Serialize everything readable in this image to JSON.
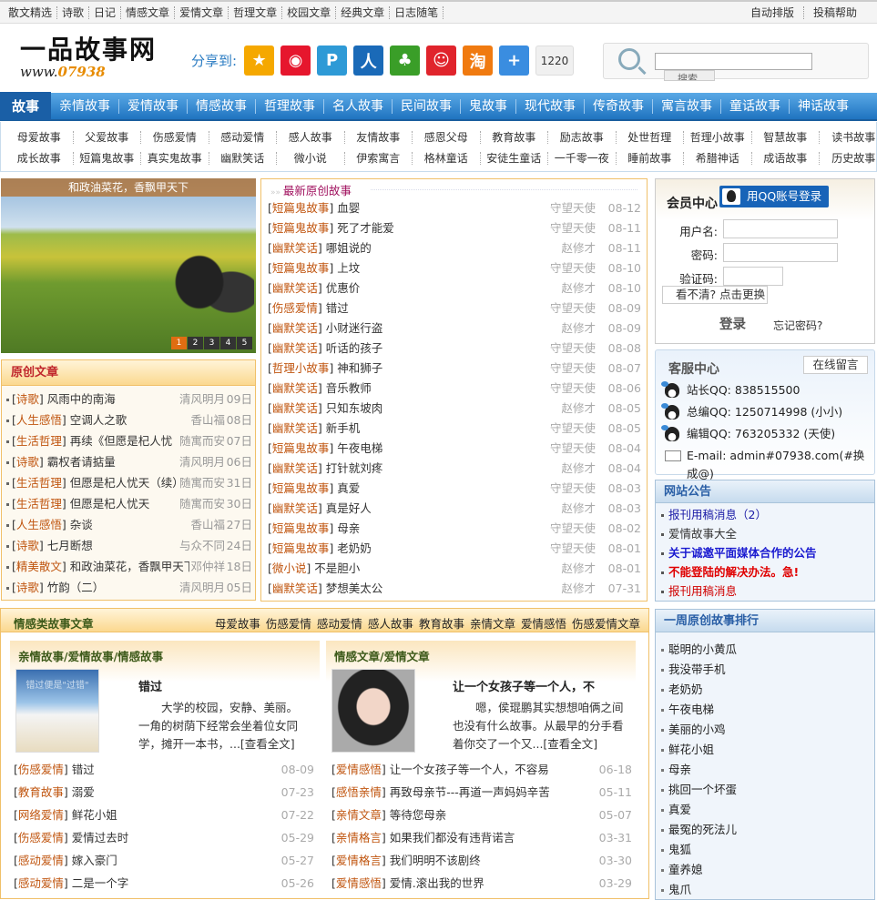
{
  "topbar": {
    "links": [
      "散文精选",
      "诗歌",
      "日记",
      "情感文章",
      "爱情文章",
      "哲理文章",
      "校园文章",
      "经典文章",
      "日志随笔"
    ],
    "right": [
      "自动排版",
      "投稿帮助"
    ]
  },
  "logo": {
    "title": "一品故事网",
    "url_prefix": "www.",
    "url_num": "07938",
    ".com": ".com"
  },
  "share": {
    "label": "分享到:",
    "icons": [
      {
        "name": "qzone-icon",
        "color": "#f5a800",
        "glyph": "★"
      },
      {
        "name": "weibo-icon",
        "color": "#e6162d",
        "glyph": "◉"
      },
      {
        "name": "tencent-weibo-icon",
        "color": "#2e9ad6",
        "glyph": "P"
      },
      {
        "name": "renren-icon",
        "color": "#1a6ab8",
        "glyph": "人"
      },
      {
        "name": "kaixin-icon",
        "color": "#3a9e28",
        "glyph": "♣"
      },
      {
        "name": "pengyou-icon",
        "color": "#e0242c",
        "glyph": "☺"
      },
      {
        "name": "taobao-icon",
        "color": "#f07a10",
        "glyph": "淘"
      },
      {
        "name": "more-share-icon",
        "color": "#3a8de0",
        "glyph": "+"
      }
    ],
    "count": "1220"
  },
  "search": {
    "value": "",
    "button": "搜索"
  },
  "nav": {
    "home": "故事",
    "items": [
      "亲情故事",
      "爱情故事",
      "情感故事",
      "哲理故事",
      "名人故事",
      "民间故事",
      "鬼故事",
      "现代故事",
      "传奇故事",
      "寓言故事",
      "童话故事",
      "神话故事"
    ]
  },
  "subnav": {
    "row1": [
      "母爱故事",
      "父爱故事",
      "伤感爱情",
      "感动爱情",
      "感人故事",
      "友情故事",
      "感恩父母",
      "教育故事",
      "励志故事",
      "处世哲理",
      "哲理小故事",
      "智慧故事",
      "读书故事"
    ],
    "row2": [
      "成长故事",
      "短篇鬼故事",
      "真实鬼故事",
      "幽默笑话",
      "微小说",
      "伊索寓言",
      "格林童话",
      "安徒生童话",
      "一千零一夜",
      "睡前故事",
      "希腊神话",
      "成语故事",
      "历史故事"
    ]
  },
  "banner": {
    "caption": "和政油菜花，香飘甲天下",
    "slides": [
      "1",
      "2",
      "3",
      "4",
      "5"
    ],
    "active_slide": 1
  },
  "original": {
    "title": "原创文章",
    "items": [
      {
        "cat": "诗歌",
        "title": "风雨中的南海",
        "author": "清风明月",
        "date": "09日"
      },
      {
        "cat": "人生感悟",
        "title": "空调人之歌",
        "author": "香山福",
        "date": "08日"
      },
      {
        "cat": "生活哲理",
        "title": "再续《但愿是杞人忧",
        "author": "随寓而安",
        "date": "07日"
      },
      {
        "cat": "诗歌",
        "title": "霸权者请掂量",
        "author": "清风明月",
        "date": "06日"
      },
      {
        "cat": "生活哲理",
        "title": "但愿是杞人忧天（续）",
        "author": "随寓而安",
        "date": "31日"
      },
      {
        "cat": "生活哲理",
        "title": "但愿是杞人忧天",
        "author": "随寓而安",
        "date": "30日"
      },
      {
        "cat": "人生感悟",
        "title": "杂谈",
        "author": "香山福",
        "date": "27日"
      },
      {
        "cat": "诗歌",
        "title": "七月断想",
        "author": "与众不同",
        "date": "24日"
      },
      {
        "cat": "精美散文",
        "title": "和政油菜花，香飘甲天下",
        "author": "邓仲祥",
        "date": "18日"
      },
      {
        "cat": "诗歌",
        "title": "竹韵（二）",
        "author": "清风明月",
        "date": "05日"
      }
    ]
  },
  "latest": {
    "title": "最新原创故事",
    "items": [
      {
        "cat": "短篇鬼故事",
        "title": "血婴",
        "author": "守望天使",
        "date": "08-12"
      },
      {
        "cat": "短篇鬼故事",
        "title": "死了才能爱",
        "author": "守望天使",
        "date": "08-11"
      },
      {
        "cat": "幽默笑话",
        "title": "哪姐说的",
        "author": "赵修才",
        "date": "08-11"
      },
      {
        "cat": "短篇鬼故事",
        "title": "上坟",
        "author": "守望天使",
        "date": "08-10"
      },
      {
        "cat": "幽默笑话",
        "title": "优惠价",
        "author": "赵修才",
        "date": "08-10"
      },
      {
        "cat": "伤感爱情",
        "title": "错过",
        "author": "守望天使",
        "date": "08-09"
      },
      {
        "cat": "幽默笑话",
        "title": "小财迷行盗",
        "author": "赵修才",
        "date": "08-09"
      },
      {
        "cat": "幽默笑话",
        "title": "听话的孩子",
        "author": "守望天使",
        "date": "08-08"
      },
      {
        "cat": "哲理小故事",
        "title": "神和狮子",
        "author": "守望天使",
        "date": "08-07"
      },
      {
        "cat": "幽默笑话",
        "title": "音乐教师",
        "author": "守望天使",
        "date": "08-06"
      },
      {
        "cat": "幽默笑话",
        "title": "只知东坡肉",
        "author": "赵修才",
        "date": "08-05"
      },
      {
        "cat": "幽默笑话",
        "title": "新手机",
        "author": "守望天使",
        "date": "08-05"
      },
      {
        "cat": "短篇鬼故事",
        "title": "午夜电梯",
        "author": "守望天使",
        "date": "08-04"
      },
      {
        "cat": "幽默笑话",
        "title": "打针就刘疼",
        "author": "赵修才",
        "date": "08-04"
      },
      {
        "cat": "短篇鬼故事",
        "title": "真爱",
        "author": "守望天使",
        "date": "08-03"
      },
      {
        "cat": "幽默笑话",
        "title": "真是好人",
        "author": "赵修才",
        "date": "08-03"
      },
      {
        "cat": "短篇鬼故事",
        "title": "母亲",
        "author": "守望天使",
        "date": "08-02"
      },
      {
        "cat": "短篇鬼故事",
        "title": "老奶奶",
        "author": "守望天使",
        "date": "08-01"
      },
      {
        "cat": "微小说",
        "title": "不是胆小",
        "author": "赵修才",
        "date": "08-01"
      },
      {
        "cat": "幽默笑话",
        "title": "梦想美太公",
        "author": "赵修才",
        "date": "07-31"
      }
    ]
  },
  "member": {
    "title": "会员中心",
    "qq_login": "用QQ账号登录",
    "username_label": "用户名:",
    "password_label": "密码:",
    "captcha_label": "验证码:",
    "captcha_refresh": "看不清? 点击更换",
    "login": "登录",
    "forgot": "忘记密码?"
  },
  "service": {
    "title": "客服中心",
    "message_button": "在线留言",
    "contacts": [
      "站长QQ: 838515500",
      "总编QQ: 1250714998 (小小)",
      "编辑QQ: 763205332 (天使)"
    ],
    "email": "E-mail: admin#07938.com(#换成@)"
  },
  "notice": {
    "title": "网站公告",
    "items": [
      {
        "text": "报刊用稿消息（2）",
        "color": "#1a1aa6",
        "bold": false
      },
      {
        "text": "爱情故事大全",
        "color": "#333333",
        "bold": false
      },
      {
        "text": "关于诚邀平面媒体合作的公告",
        "color": "#1a1ad0",
        "bold": true
      },
      {
        "text": "不能登陆的解决办法。急!",
        "color": "#e00000",
        "bold": true
      },
      {
        "text": "报刊用稿消息",
        "color": "#d00000",
        "bold": false
      }
    ]
  },
  "rank": {
    "title": "一周原创故事排行",
    "items": [
      "聪明的小黄瓜",
      "我没带手机",
      "老奶奶",
      "午夜电梯",
      "美丽的小鸡",
      "鲜花小姐",
      "母亲",
      "挑回一个坏蛋",
      "真爱",
      "最冤的死法儿",
      "鬼狐",
      "童养媳",
      "鬼爪"
    ]
  },
  "emotion": {
    "title": "情感类故事文章",
    "tabs": [
      "母爱故事",
      "伤感爱情",
      "感动爱情",
      "感人故事",
      "教育故事",
      "亲情文章",
      "爱情感悟",
      "伤感爱情文章"
    ],
    "left": {
      "title": "亲情故事/爱情故事/情感故事",
      "image_text": "错过便是\"过错\"",
      "headline": "错过",
      "summary": "大学的校园，安静、美丽。 一角的树荫下经常会坐着位女同学，摊开一本书，...",
      "more": "[查看全文]",
      "items": [
        {
          "cat": "伤感爱情",
          "title": "错过",
          "date": "08-09"
        },
        {
          "cat": "教育故事",
          "title": "溺爱",
          "date": "07-23"
        },
        {
          "cat": "网络爱情",
          "title": "鲜花小姐",
          "date": "07-22"
        },
        {
          "cat": "伤感爱情",
          "title": "爱情过去时",
          "date": "05-29"
        },
        {
          "cat": "感动爱情",
          "title": "嫁入豪门",
          "date": "05-27"
        },
        {
          "cat": "感动爱情",
          "title": "二是一个字",
          "date": "05-26"
        }
      ]
    },
    "right": {
      "title": "情感文章/爱情文章",
      "headline": "让一个女孩子等一个人，不",
      "summary": "嗯，侯琨鹏其实想想咱俩之间也没有什么故事。从最早的分手看着你交了一个又...",
      "more": "[查看全文]",
      "items": [
        {
          "cat": "爱情感悟",
          "title": "让一个女孩子等一个人，不容易",
          "date": "06-18"
        },
        {
          "cat": "感悟亲情",
          "title": "再致母亲节---再道一声妈妈辛苦",
          "date": "05-11"
        },
        {
          "cat": "亲情文章",
          "title": "等待您母亲",
          "date": "05-07"
        },
        {
          "cat": "亲情格言",
          "title": "如果我们都没有违背诺言",
          "date": "03-31"
        },
        {
          "cat": "爱情格言",
          "title": "我们明明不该剧终",
          "date": "03-30"
        },
        {
          "cat": "爱情感悟",
          "title": "爱情.滚出我的世界",
          "date": "03-29"
        }
      ]
    }
  }
}
